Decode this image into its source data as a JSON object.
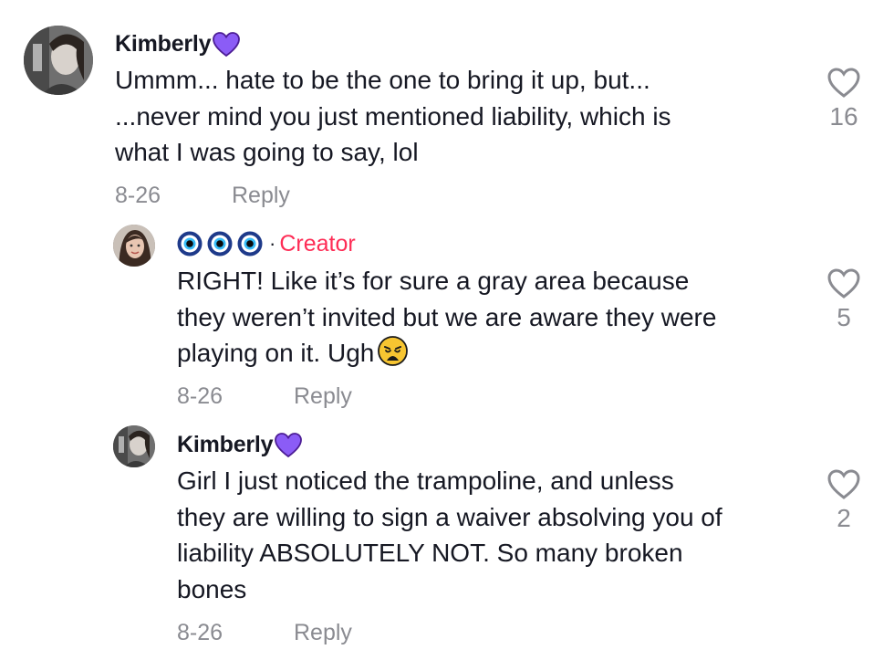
{
  "comments": [
    {
      "author": "Kimberly",
      "badge_icon": "purple-heart-icon",
      "text": "Ummm... hate to be the one to bring it up, but...\n...never mind you just mentioned liability, which is\nwhat I was going to say, lol",
      "date": "8-26",
      "reply_label": "Reply",
      "likes": "16"
    },
    {
      "author_icons": [
        "nazar-eye-icon",
        "nazar-eye-icon",
        "nazar-eye-icon"
      ],
      "separator": "·",
      "creator_label": "Creator",
      "text": "RIGHT! Like it’s for sure a gray area because\nthey weren’t invited but we are aware they were\nplaying on it. Ugh",
      "emoji": "weary-face-emoji",
      "date": "8-26",
      "reply_label": "Reply",
      "likes": "5"
    },
    {
      "author": "Kimberly",
      "badge_icon": "purple-heart-icon",
      "text": "Girl I just noticed the trampoline, and unless\nthey are willing to sign a waiver absolving you of\nliability ABSOLUTELY NOT. So many broken\nbones",
      "date": "8-26",
      "reply_label": "Reply",
      "likes": "2"
    }
  ],
  "colors": {
    "text": "#161823",
    "muted": "#8a8b91",
    "creator": "#fe2c55",
    "badge": "#8b5cf6"
  }
}
